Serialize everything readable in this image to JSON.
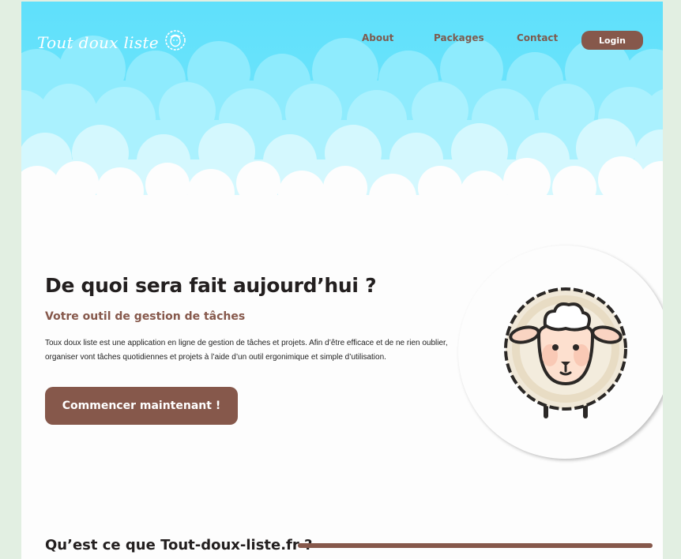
{
  "header": {
    "logo_text": "Tout doux liste",
    "logo_icon": "sheep-icon",
    "nav": {
      "about": "About",
      "packages": "Packages",
      "contact": "Contact"
    },
    "login_label": "Login"
  },
  "hero": {
    "title": "De quoi sera fait aujourd’hui ?",
    "subtitle": "Votre outil de gestion de tâches",
    "description": "Toux doux liste est une application en ligne de gestion de tâches et projets. Afin d’être efficace et de ne rien oublier, organiser vont tâches quotidiennes et projets à l’aide d’un outil ergonimique et simple d’utilisation.",
    "cta_label": "Commencer maintenant !",
    "illustration": "sheep-icon"
  },
  "section": {
    "title": "Qu’est ce que Tout-doux-liste.fr ?"
  },
  "colors": {
    "accent": "#86584b",
    "sky": "#5fe0fb",
    "background": "#e2efe2"
  }
}
